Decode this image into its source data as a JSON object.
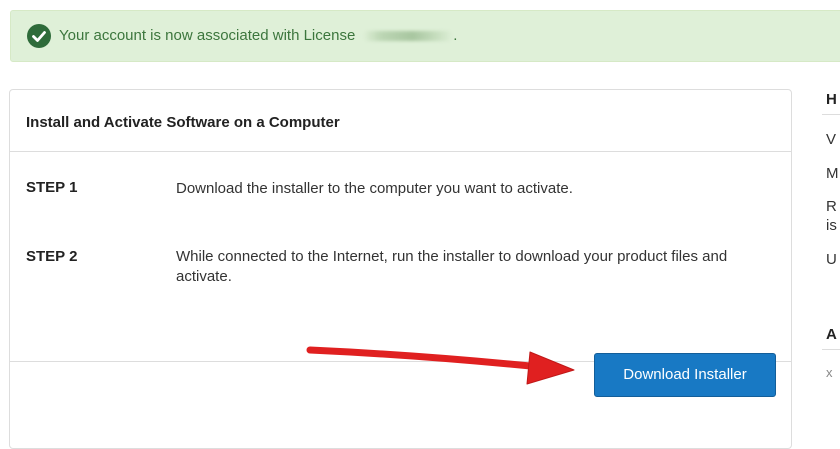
{
  "alert": {
    "message": "Your account is now associated with License",
    "suffix": "."
  },
  "panel": {
    "title": "Install and Activate Software on a Computer",
    "steps": [
      {
        "label": "STEP 1",
        "text": "Download the installer to the computer you want to activate."
      },
      {
        "label": "STEP 2",
        "text": "While connected to the Internet, run the installer to download your product files and activate."
      }
    ],
    "download_button": "Download Installer"
  },
  "sidebar": {
    "heading_1": "H",
    "items": [
      "V",
      "M",
      "R",
      "is",
      "U"
    ],
    "heading_2": "A",
    "item_bottom": "x"
  },
  "colors": {
    "alert_bg": "#dff0d8",
    "alert_text": "#3c763d",
    "button_bg": "#1879c4",
    "arrow": "#e02020"
  },
  "icons": {
    "alert": "check-circle-icon",
    "annotation": "red-arrow-icon"
  }
}
